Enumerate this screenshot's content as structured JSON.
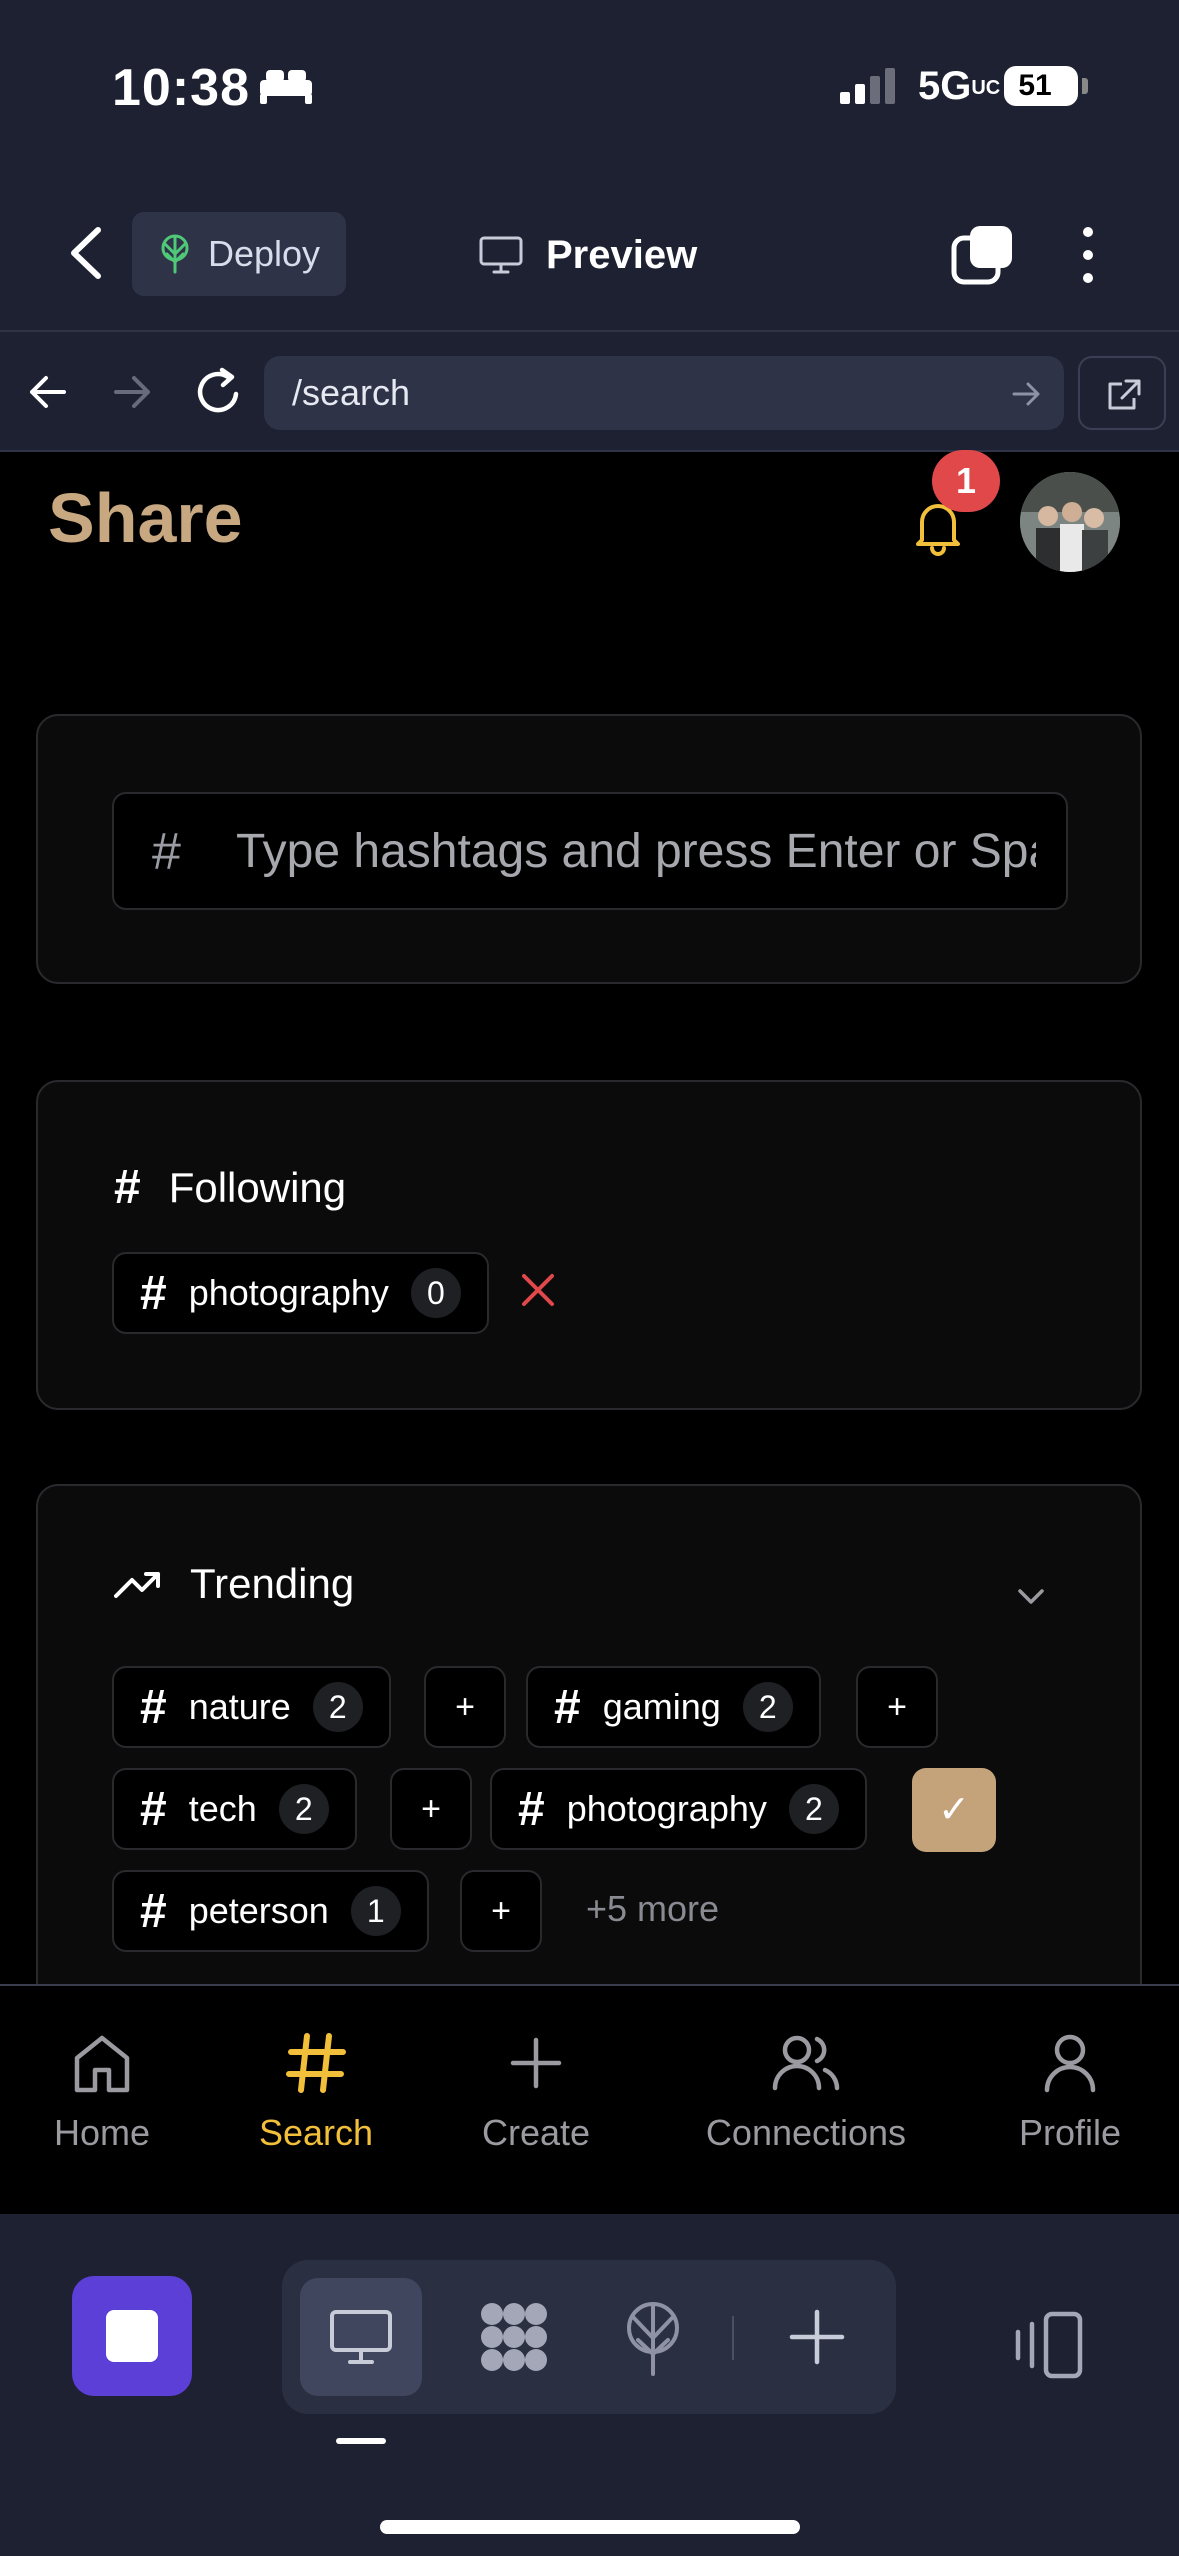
{
  "status_bar": {
    "time": "10:38",
    "network": "5G",
    "network_sub": "UC",
    "battery": "51"
  },
  "browser": {
    "deploy_label": "Deploy",
    "preview_label": "Preview",
    "url": "/search"
  },
  "app": {
    "title": "Share",
    "notification_count": "1",
    "search": {
      "hash": "#",
      "placeholder": "Type hashtags and press Enter or Space"
    },
    "following": {
      "heading": "Following",
      "tags": [
        {
          "name": "photography",
          "count": "0"
        }
      ]
    },
    "trending": {
      "heading": "Trending",
      "tags": [
        {
          "name": "nature",
          "count": "2",
          "action": "+"
        },
        {
          "name": "gaming",
          "count": "2",
          "action": "+"
        },
        {
          "name": "tech",
          "count": "2",
          "action": "+"
        },
        {
          "name": "photography",
          "count": "2",
          "action": "✓"
        },
        {
          "name": "peterson",
          "count": "1",
          "action": "+"
        }
      ],
      "more_label": "+5 more"
    }
  },
  "bottom_nav": {
    "items": [
      {
        "label": "Home",
        "icon": "home-icon"
      },
      {
        "label": "Search",
        "icon": "hashtag-icon",
        "active": true
      },
      {
        "label": "Create",
        "icon": "plus-icon"
      },
      {
        "label": "Connections",
        "icon": "users-icon"
      },
      {
        "label": "Profile",
        "icon": "user-icon"
      }
    ]
  },
  "colors": {
    "accent": "#c7a881",
    "active_nav": "#f2bf3b",
    "badge": "#e0484a",
    "stop": "#5b3fd6"
  }
}
